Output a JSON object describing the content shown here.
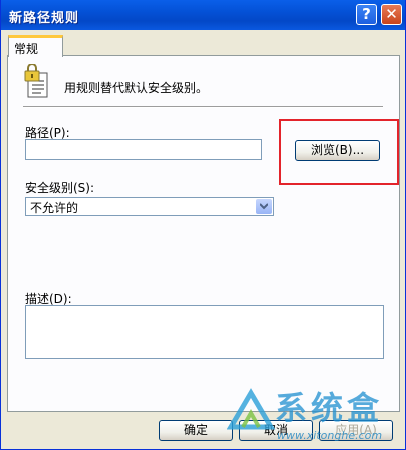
{
  "window": {
    "title": "新路径规则"
  },
  "title_buttons": {
    "help": "?",
    "close": "✕"
  },
  "tabs": [
    {
      "label": "常规"
    }
  ],
  "general": {
    "description": "用规则替代默认安全级别。",
    "path_label": "路径(P):",
    "path_value": "",
    "browse_label": "浏览(B)...",
    "security_level_label": "安全级别(S):",
    "security_level_value": "不允许的",
    "description_label": "描述(D):",
    "description_value": ""
  },
  "footer": {
    "ok_label": "确定",
    "cancel_label": "取消",
    "apply_label": "应用(A)"
  },
  "watermark": {
    "brand": "系统盒",
    "url": "www.xitonghe.com"
  },
  "colors": {
    "titlebar": "#0451d6",
    "highlight_box": "#e3242b",
    "tab_accent": "#ffc83c"
  },
  "icons": {
    "policy": "lock-document-icon",
    "dropdown": "chevron-down-icon"
  }
}
